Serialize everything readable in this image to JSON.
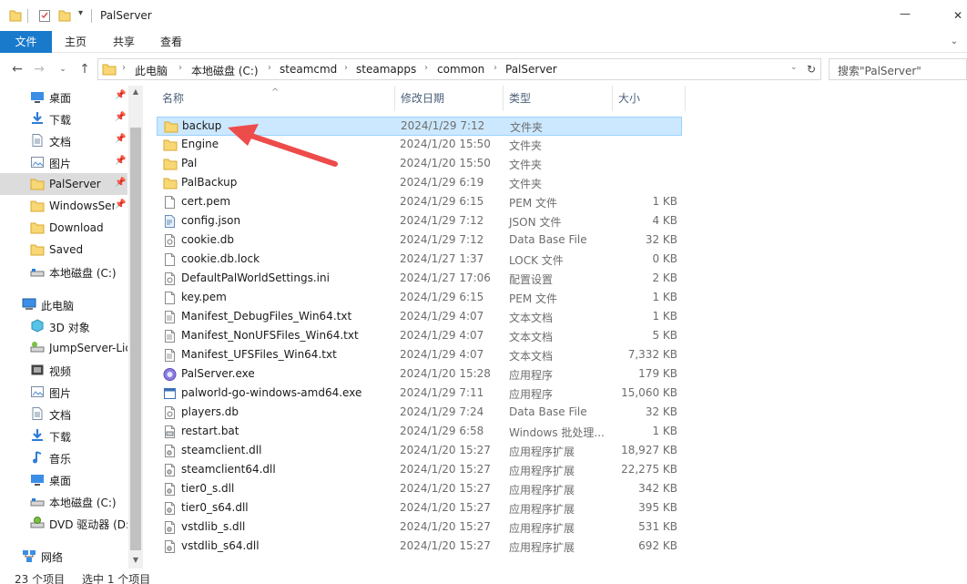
{
  "window": {
    "title": "PalServer",
    "minimize_glyph": "—",
    "maximize_glyph": "☐",
    "close_glyph": "✕"
  },
  "ribbon": {
    "tabs": [
      "文件",
      "主页",
      "共享",
      "查看"
    ]
  },
  "address": {
    "crumbs": [
      "此电脑",
      "本地磁盘 (C:)",
      "steamcmd",
      "steamapps",
      "common",
      "PalServer"
    ]
  },
  "search": {
    "placeholder": "搜索\"PalServer\""
  },
  "nav": {
    "quick_access": [
      {
        "label": "桌面",
        "icon": "desktop-icon",
        "pinned": true
      },
      {
        "label": "下载",
        "icon": "download-icon",
        "pinned": true
      },
      {
        "label": "文档",
        "icon": "document-icon",
        "pinned": true
      },
      {
        "label": "图片",
        "icon": "picture-icon",
        "pinned": true
      },
      {
        "label": "PalServer",
        "icon": "folder-icon",
        "pinned": true,
        "selected": true
      },
      {
        "label": "WindowsSer",
        "icon": "folder-icon",
        "pinned": true
      },
      {
        "label": "Download",
        "icon": "folder-icon",
        "pinned": false
      },
      {
        "label": "Saved",
        "icon": "folder-icon",
        "pinned": false
      },
      {
        "label": "本地磁盘 (C:)",
        "icon": "drive-icon",
        "pinned": false
      }
    ],
    "this_pc_label": "此电脑",
    "this_pc": [
      {
        "label": "3D 对象",
        "icon": "3d-objects-icon"
      },
      {
        "label": "JumpServer-Lic",
        "icon": "network-drive-icon"
      },
      {
        "label": "视频",
        "icon": "video-icon"
      },
      {
        "label": "图片",
        "icon": "picture-icon"
      },
      {
        "label": "文档",
        "icon": "document-icon"
      },
      {
        "label": "下载",
        "icon": "download-icon"
      },
      {
        "label": "音乐",
        "icon": "music-icon"
      },
      {
        "label": "桌面",
        "icon": "desktop-icon"
      },
      {
        "label": "本地磁盘 (C:)",
        "icon": "drive-icon"
      },
      {
        "label": "DVD 驱动器 (D:",
        "icon": "dvd-icon"
      }
    ],
    "network_label": "网络"
  },
  "columns": {
    "name": "名称",
    "date": "修改日期",
    "type": "类型",
    "size": "大小"
  },
  "files": [
    {
      "name": "backup",
      "date": "2024/1/29 7:12",
      "type": "文件夹",
      "size": "",
      "icon": "folder-icon",
      "selected": true
    },
    {
      "name": "Engine",
      "date": "2024/1/20 15:50",
      "type": "文件夹",
      "size": "",
      "icon": "folder-icon"
    },
    {
      "name": "Pal",
      "date": "2024/1/20 15:50",
      "type": "文件夹",
      "size": "",
      "icon": "folder-icon"
    },
    {
      "name": "PalBackup",
      "date": "2024/1/29 6:19",
      "type": "文件夹",
      "size": "",
      "icon": "folder-icon"
    },
    {
      "name": "cert.pem",
      "date": "2024/1/29 6:15",
      "type": "PEM 文件",
      "size": "1 KB",
      "icon": "file-icon"
    },
    {
      "name": "config.json",
      "date": "2024/1/29 7:12",
      "type": "JSON 文件",
      "size": "4 KB",
      "icon": "json-file-icon"
    },
    {
      "name": "cookie.db",
      "date": "2024/1/29 7:12",
      "type": "Data Base File",
      "size": "32 KB",
      "icon": "settings-file-icon"
    },
    {
      "name": "cookie.db.lock",
      "date": "2024/1/27 1:37",
      "type": "LOCK 文件",
      "size": "0 KB",
      "icon": "file-icon"
    },
    {
      "name": "DefaultPalWorldSettings.ini",
      "date": "2024/1/27 17:06",
      "type": "配置设置",
      "size": "2 KB",
      "icon": "settings-file-icon"
    },
    {
      "name": "key.pem",
      "date": "2024/1/29 6:15",
      "type": "PEM 文件",
      "size": "1 KB",
      "icon": "file-icon"
    },
    {
      "name": "Manifest_DebugFiles_Win64.txt",
      "date": "2024/1/29 4:07",
      "type": "文本文档",
      "size": "1 KB",
      "icon": "text-file-icon"
    },
    {
      "name": "Manifest_NonUFSFiles_Win64.txt",
      "date": "2024/1/29 4:07",
      "type": "文本文档",
      "size": "5 KB",
      "icon": "text-file-icon"
    },
    {
      "name": "Manifest_UFSFiles_Win64.txt",
      "date": "2024/1/29 4:07",
      "type": "文本文档",
      "size": "7,332 KB",
      "icon": "text-file-icon"
    },
    {
      "name": "PalServer.exe",
      "date": "2024/1/20 15:28",
      "type": "应用程序",
      "size": "179 KB",
      "icon": "palserver-app-icon"
    },
    {
      "name": "palworld-go-windows-amd64.exe",
      "date": "2024/1/29 7:11",
      "type": "应用程序",
      "size": "15,060 KB",
      "icon": "exe-window-icon"
    },
    {
      "name": "players.db",
      "date": "2024/1/29 7:24",
      "type": "Data Base File",
      "size": "32 KB",
      "icon": "settings-file-icon"
    },
    {
      "name": "restart.bat",
      "date": "2024/1/29 6:58",
      "type": "Windows 批处理...",
      "size": "1 KB",
      "icon": "batch-file-icon"
    },
    {
      "name": "steamclient.dll",
      "date": "2024/1/20 15:27",
      "type": "应用程序扩展",
      "size": "18,927 KB",
      "icon": "dll-file-icon"
    },
    {
      "name": "steamclient64.dll",
      "date": "2024/1/20 15:27",
      "type": "应用程序扩展",
      "size": "22,275 KB",
      "icon": "dll-file-icon"
    },
    {
      "name": "tier0_s.dll",
      "date": "2024/1/20 15:27",
      "type": "应用程序扩展",
      "size": "342 KB",
      "icon": "dll-file-icon"
    },
    {
      "name": "tier0_s64.dll",
      "date": "2024/1/20 15:27",
      "type": "应用程序扩展",
      "size": "395 KB",
      "icon": "dll-file-icon"
    },
    {
      "name": "vstdlib_s.dll",
      "date": "2024/1/20 15:27",
      "type": "应用程序扩展",
      "size": "531 KB",
      "icon": "dll-file-icon"
    },
    {
      "name": "vstdlib_s64.dll",
      "date": "2024/1/20 15:27",
      "type": "应用程序扩展",
      "size": "692 KB",
      "icon": "dll-file-icon"
    }
  ],
  "status": {
    "count": "23 个项目",
    "selected": "选中 1 个项目"
  },
  "colors": {
    "accent": "#1979ca",
    "selection_bg": "#cce8ff",
    "selection_border": "#99d1ff",
    "folder": "#f8d775",
    "annotation_arrow": "#ee4b4b"
  }
}
